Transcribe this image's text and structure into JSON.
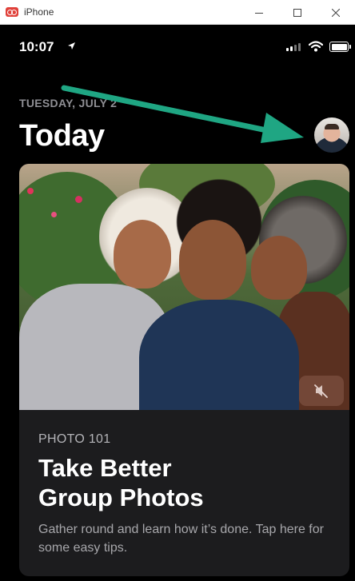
{
  "window": {
    "title": "iPhone",
    "controls": [
      "minimize",
      "maximize",
      "close"
    ]
  },
  "status_bar": {
    "time": "10:07",
    "icons": [
      "location-arrow-icon",
      "signal-icon",
      "wifi-icon",
      "battery-icon"
    ]
  },
  "header": {
    "date": "TUESDAY, JULY 2",
    "title": "Today",
    "avatar_icon": "profile-avatar"
  },
  "annotation": {
    "arrow_color": "#1fa683",
    "points_to": "profile-avatar"
  },
  "story_card": {
    "eyebrow": "PHOTO 101",
    "title": "Take Better Group Photos",
    "description": "Gather round and learn how it’s done. Tap here for some easy tips.",
    "media_control_icon": "speaker-muted-icon"
  },
  "colors": {
    "background": "#000000",
    "card_background": "#1c1c1e",
    "secondary_text": "#8e8e93"
  }
}
